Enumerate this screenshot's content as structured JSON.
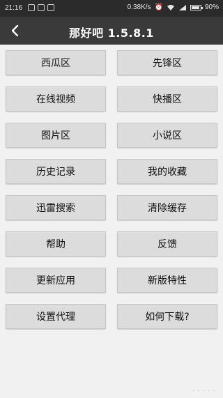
{
  "status_bar": {
    "time": "21:16",
    "network_speed": "0.38K/s",
    "battery": "90%",
    "battery_level": 0.9
  },
  "title_bar": {
    "title": "那好吧 1.5.8.1",
    "back_icon": "chevron-left-icon"
  },
  "menu": {
    "rows": [
      {
        "left": "西瓜区",
        "right": "先锋区"
      },
      {
        "left": "在线视频",
        "right": "快播区"
      },
      {
        "left": "图片区",
        "right": "小说区"
      },
      {
        "left": "历史记录",
        "right": "我的收藏"
      },
      {
        "left": "迅雷搜索",
        "right": "清除缓存"
      },
      {
        "left": "帮助",
        "right": "反馈"
      },
      {
        "left": "更新应用",
        "right": "新版特性"
      },
      {
        "left": "设置代理",
        "right": "如何下载?"
      }
    ]
  },
  "colors": {
    "status_bar_bg": "#2b2b2b",
    "title_bar_bg": "#3a3a3a",
    "page_bg": "#f1f1f1",
    "button_bg": "#dcdcdc"
  }
}
